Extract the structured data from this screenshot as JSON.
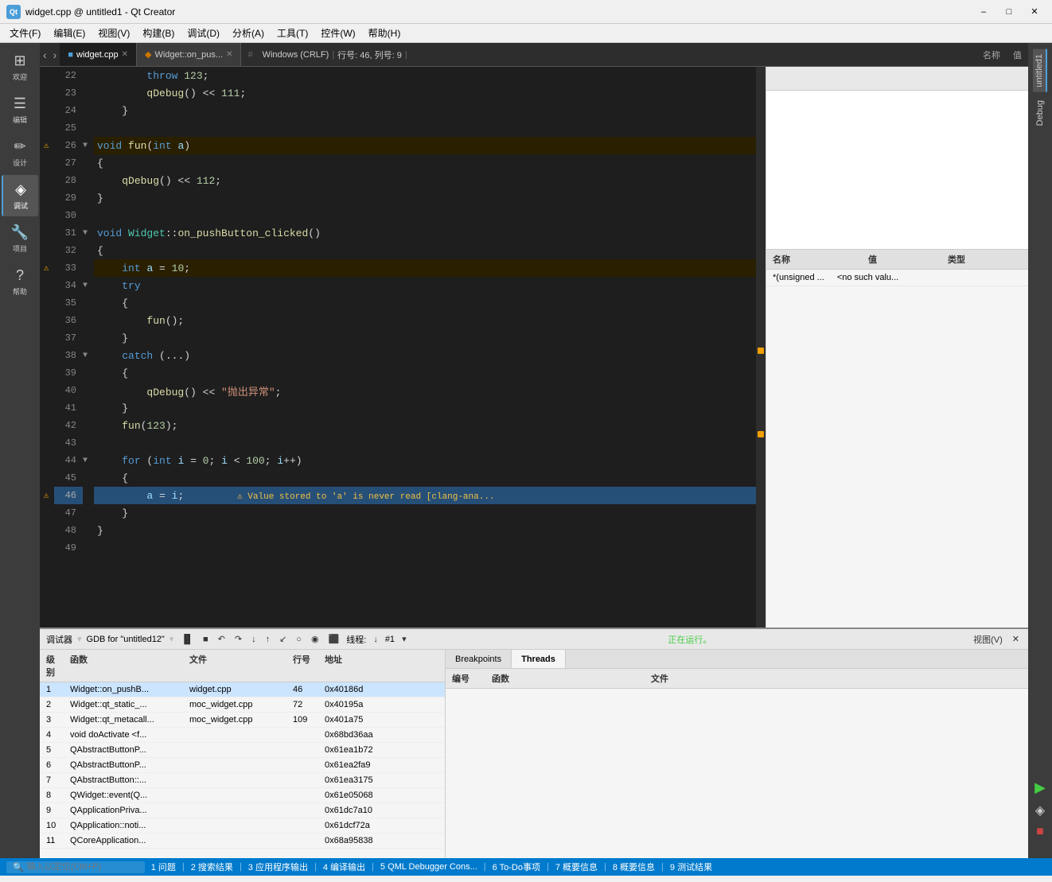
{
  "titlebar": {
    "title": "widget.cpp @ untitled1 - Qt Creator",
    "app_icon": "Qt",
    "minimize": "–",
    "maximize": "□",
    "close": "✕"
  },
  "menubar": {
    "items": [
      "文件(F)",
      "编辑(E)",
      "视图(V)",
      "构建(B)",
      "调试(D)",
      "分析(A)",
      "工具(T)",
      "控件(W)",
      "帮助(H)"
    ]
  },
  "sidebar": {
    "items": [
      {
        "id": "welcome",
        "icon": "⊞",
        "label": "欢迎"
      },
      {
        "id": "edit",
        "icon": "≡",
        "label": "编辑"
      },
      {
        "id": "design",
        "icon": "✏",
        "label": "设计"
      },
      {
        "id": "debug",
        "icon": "◈",
        "label": "调试"
      },
      {
        "id": "project",
        "icon": "🔧",
        "label": "项目"
      },
      {
        "id": "help",
        "icon": "?",
        "label": "帮助"
      }
    ]
  },
  "tabs": [
    {
      "name": "widget.cpp",
      "active": true,
      "dirty": false
    },
    {
      "name": "Widget::on_pus...",
      "active": false
    }
  ],
  "infobar": {
    "encoding": "# Windows (CRLF)",
    "position": "行号: 46, 列号: 9"
  },
  "right_panel": {
    "header_name": "名称",
    "header_value": "值",
    "watch_headers": [
      "名称",
      "值",
      "类型"
    ],
    "watch_rows": [
      {
        "name": "*(unsigned ...",
        "value": "<no such valu...",
        "type": ""
      }
    ]
  },
  "code": {
    "lines": [
      {
        "num": 22,
        "indent": 2,
        "content": "throw 123;",
        "type": "code",
        "arrow": ""
      },
      {
        "num": 23,
        "indent": 2,
        "content": "qDebug() << 111;",
        "type": "code",
        "arrow": ""
      },
      {
        "num": 24,
        "indent": 1,
        "content": "}",
        "type": "code",
        "arrow": ""
      },
      {
        "num": 25,
        "indent": 0,
        "content": "",
        "type": "empty",
        "arrow": ""
      },
      {
        "num": 26,
        "indent": 0,
        "content": "void fun(int a)",
        "type": "code",
        "arrow": "▼",
        "warning": true
      },
      {
        "num": 27,
        "indent": 0,
        "content": "{",
        "type": "code",
        "arrow": ""
      },
      {
        "num": 28,
        "indent": 1,
        "content": "qDebug() << 112;",
        "type": "code",
        "arrow": ""
      },
      {
        "num": 29,
        "indent": 0,
        "content": "}",
        "type": "code",
        "arrow": ""
      },
      {
        "num": 30,
        "indent": 0,
        "content": "",
        "type": "empty",
        "arrow": ""
      },
      {
        "num": 31,
        "indent": 0,
        "content": "void Widget::on_pushButton_clicked()",
        "type": "code",
        "arrow": "▼"
      },
      {
        "num": 32,
        "indent": 0,
        "content": "{",
        "type": "code",
        "arrow": ""
      },
      {
        "num": 33,
        "indent": 1,
        "content": "int a = 10;",
        "type": "code",
        "arrow": "",
        "warning": true
      },
      {
        "num": 34,
        "indent": 1,
        "content": "try",
        "type": "code",
        "arrow": "▼"
      },
      {
        "num": 35,
        "indent": 1,
        "content": "{",
        "type": "code",
        "arrow": ""
      },
      {
        "num": 36,
        "indent": 2,
        "content": "fun();",
        "type": "code",
        "arrow": ""
      },
      {
        "num": 37,
        "indent": 1,
        "content": "}",
        "type": "code",
        "arrow": ""
      },
      {
        "num": 38,
        "indent": 1,
        "content": "catch (...)",
        "type": "code",
        "arrow": "▼"
      },
      {
        "num": 39,
        "indent": 1,
        "content": "{",
        "type": "code",
        "arrow": ""
      },
      {
        "num": 40,
        "indent": 2,
        "content": "qDebug() << \"抛出异常\";",
        "type": "code",
        "arrow": ""
      },
      {
        "num": 41,
        "indent": 1,
        "content": "}",
        "type": "code",
        "arrow": ""
      },
      {
        "num": 42,
        "indent": 1,
        "content": "fun(123);",
        "type": "code",
        "arrow": ""
      },
      {
        "num": 43,
        "indent": 0,
        "content": "",
        "type": "empty",
        "arrow": ""
      },
      {
        "num": 44,
        "indent": 1,
        "content": "for (int i = 0; i < 100; i++)",
        "type": "code",
        "arrow": "▼"
      },
      {
        "num": 45,
        "indent": 1,
        "content": "{",
        "type": "code",
        "arrow": ""
      },
      {
        "num": 46,
        "indent": 2,
        "content": "a = i;",
        "type": "code",
        "arrow": "",
        "warning": true,
        "highlighted": true,
        "inline_warn": "⚠ Value stored to 'a' is never read [clang-ana..."
      },
      {
        "num": 47,
        "indent": 1,
        "content": "}",
        "type": "code",
        "arrow": ""
      },
      {
        "num": 48,
        "indent": 0,
        "content": "}",
        "type": "code",
        "arrow": ""
      },
      {
        "num": 49,
        "indent": 0,
        "content": "",
        "type": "empty",
        "arrow": ""
      }
    ]
  },
  "debugger": {
    "label": "调试器",
    "gdb_label": "GDB for \"untitled12\"",
    "status": "正在运行。",
    "running_label": "正在运行。",
    "toolbar_buttons": [
      "▐▌",
      "■",
      "↶",
      "↷",
      "↓",
      "↑",
      "↙",
      "○",
      "◉",
      "⬛",
      "线程:",
      "↓",
      "#1",
      "▾"
    ],
    "view_label": "视图(V)"
  },
  "stack_panel": {
    "headers": [
      "级别",
      "函数",
      "文件",
      "行号",
      "地址"
    ],
    "rows": [
      {
        "level": "1",
        "fn": "Widget::on_pushB...",
        "file": "widget.cpp",
        "line": "46",
        "addr": "0x40186d"
      },
      {
        "level": "2",
        "fn": "Widget::qt_static_...",
        "file": "moc_widget.cpp",
        "line": "72",
        "addr": "0x40195a"
      },
      {
        "level": "3",
        "fn": "Widget::qt_metacall...",
        "file": "moc_widget.cpp",
        "line": "109",
        "addr": "0x401a75"
      },
      {
        "level": "4",
        "fn": "void doActivate <f...",
        "file": "",
        "line": "",
        "addr": "0x68bd36aa"
      },
      {
        "level": "5",
        "fn": "QAbstractButtonP...",
        "file": "",
        "line": "",
        "addr": "0x61ea1b72"
      },
      {
        "level": "6",
        "fn": "QAbstractButtonP...",
        "file": "",
        "line": "",
        "addr": "0x61ea2fa9"
      },
      {
        "level": "7",
        "fn": "QAbstractButton::...",
        "file": "",
        "line": "",
        "addr": "0x61ea3175"
      },
      {
        "level": "8",
        "fn": "QWidget::event(Q...",
        "file": "",
        "line": "",
        "addr": "0x61e05068"
      },
      {
        "level": "9",
        "fn": "QApplicationPriva...",
        "file": "",
        "line": "",
        "addr": "0x61dc7a10"
      },
      {
        "level": "10",
        "fn": "QApplication::noti...",
        "file": "",
        "line": "",
        "addr": "0x61dcf72a"
      },
      {
        "level": "11",
        "fn": "QCoreApplication...",
        "file": "",
        "line": "",
        "addr": "0x68a95838"
      }
    ]
  },
  "threads_panel": {
    "tabs": [
      "Breakpoints",
      "Threads"
    ],
    "active_tab": "Threads",
    "headers": [
      "编号",
      "函数",
      "文件"
    ]
  },
  "project_sidebar": {
    "label": "untitled1",
    "debug_label": "Debug"
  },
  "statusbar": {
    "search_placeholder": "输入以定位(Ctrl+P)",
    "items": [
      "1 问题",
      "2 搜索结果",
      "3 应用程序输出",
      "4 编译输出",
      "5 QML Debugger Cons...",
      "6 To-Do事项",
      "7 概要信息",
      "8 概要信息",
      "9 测试结果"
    ]
  }
}
